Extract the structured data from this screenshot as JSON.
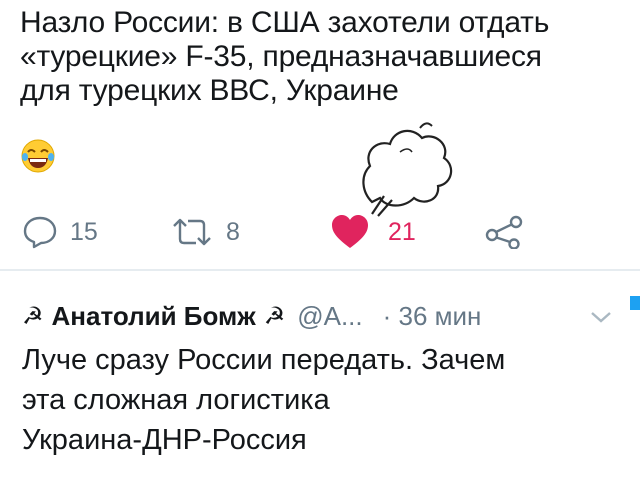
{
  "tweet": {
    "lines": [
      "Назло России: в США захотели отдать",
      "«турецкие» F-35, предназначавшиеся",
      "для турецких ВВС, Украине"
    ],
    "emoji": "face-with-tears-of-joy"
  },
  "actions": {
    "replies": "15",
    "retweets": "8",
    "likes": "21"
  },
  "colors": {
    "like": "#e0245e",
    "muted": "#657786",
    "accent": "#1da1f2"
  },
  "reply": {
    "symbol": "☭",
    "name": "Анатолий Бомж",
    "handle": "@А...",
    "time": "· 36 мин",
    "lines": [
      "Луче сразу России передать. Зачем",
      "эта сложная логистика",
      "Украина-ДНР-Россия"
    ]
  }
}
